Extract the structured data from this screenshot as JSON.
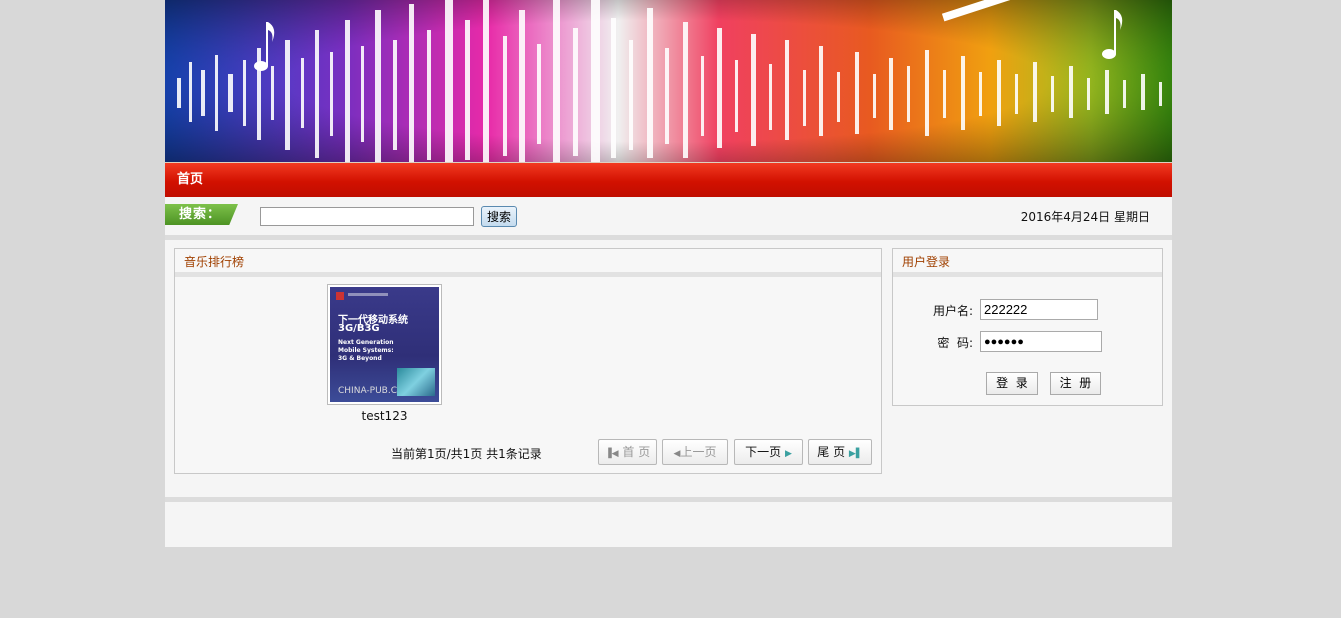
{
  "nav": {
    "home_label": "首页"
  },
  "search": {
    "tag_label": "搜索：",
    "input_value": "",
    "button_label": "搜索"
  },
  "date_text": "2016年4月24日 星期日",
  "ranking": {
    "title": "音乐排行榜",
    "items": [
      {
        "caption": "test123",
        "cover": {
          "line1": "下一代移动系统",
          "line2": "3G/B3G",
          "line3": "Next Generation Mobile Systems: 3G & Beyond",
          "brand": "CHINA-PUB.COM"
        }
      }
    ],
    "pager": {
      "info": "当前第1页/共1页  共1条记录",
      "first": "首 页",
      "prev": "上一页",
      "next": "下一页",
      "last": "尾 页"
    }
  },
  "login": {
    "title": "用户登录",
    "username_label": "用户名:",
    "username_value": "222222",
    "password_label": "密  码:",
    "password_value": "●●●●●●",
    "login_button": "登  录",
    "register_button": "注  册"
  },
  "colors": {
    "nav_red": "#d21100",
    "accent_green": "#4d9324",
    "panel_title": "#a04000"
  }
}
